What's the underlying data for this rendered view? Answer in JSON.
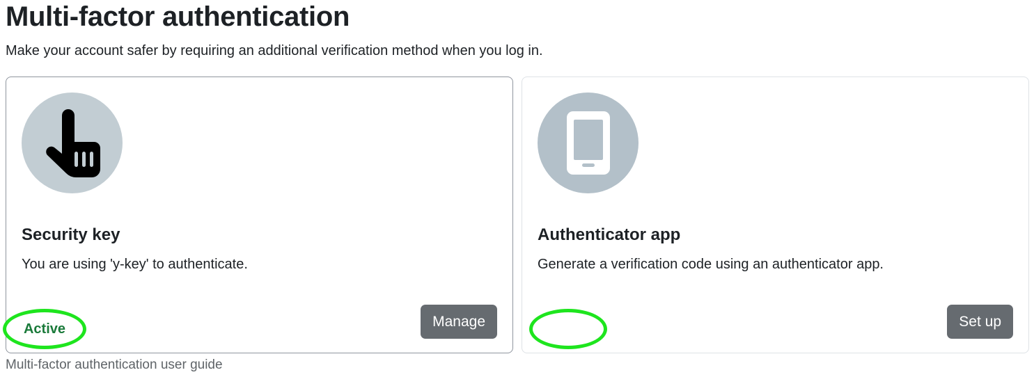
{
  "page": {
    "title": "Multi-factor authentication",
    "subtitle": "Make your account safer by requiring an additional verification method when you log in."
  },
  "factors": [
    {
      "icon": "pointing-hand-icon",
      "title": "Security key",
      "description": "You are using 'y-key' to authenticate.",
      "status": "Active",
      "button_label": "Manage",
      "status_color": "#1a7a3a"
    },
    {
      "icon": "mobile-phone-icon",
      "title": "Authenticator app",
      "description": "Generate a verification code using an authenticator app.",
      "status": "",
      "button_label": "Set up"
    }
  ],
  "footer": {
    "link_text": "Multi-factor authentication user guide"
  },
  "colors": {
    "button_bg": "#666b70",
    "highlight": "#1ee51e",
    "icon_circle": "#c2cdd3"
  }
}
